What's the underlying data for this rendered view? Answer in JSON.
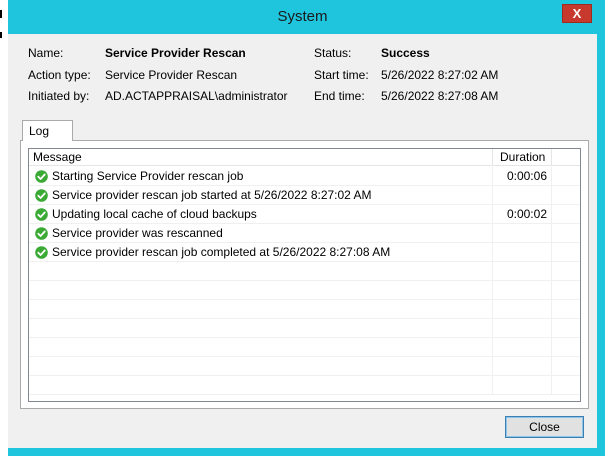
{
  "window": {
    "title": "System",
    "close_glyph": "X"
  },
  "details": {
    "name_label": "Name:",
    "name_value": "Service Provider Rescan",
    "action_label": "Action type:",
    "action_value": "Service Provider Rescan",
    "initiated_label": "Initiated by:",
    "initiated_value": "AD.ACTAPPRAISAL\\administrator",
    "status_label": "Status:",
    "status_value": "Success",
    "start_label": "Start time:",
    "start_value": "5/26/2022 8:27:02 AM",
    "end_label": "End time:",
    "end_value": "5/26/2022 8:27:08 AM"
  },
  "tabs": {
    "log_label": "Log"
  },
  "log": {
    "columns": {
      "message": "Message",
      "duration": "Duration"
    },
    "rows": [
      {
        "icon": "success-check-icon",
        "message": "Starting Service Provider rescan job",
        "duration": "0:00:06"
      },
      {
        "icon": "success-check-icon",
        "message": "Service provider rescan job started at 5/26/2022 8:27:02 AM",
        "duration": ""
      },
      {
        "icon": "success-check-icon",
        "message": "Updating local cache of cloud backups",
        "duration": "0:00:02"
      },
      {
        "icon": "success-check-icon",
        "message": "Service provider was rescanned",
        "duration": ""
      },
      {
        "icon": "success-check-icon",
        "message": "Service provider rescan job completed at 5/26/2022 8:27:08 AM",
        "duration": ""
      }
    ]
  },
  "footer": {
    "close_label": "Close"
  },
  "colors": {
    "titlebar": "#1fc4dd",
    "success": "#3aaa35",
    "close_x": "#c7392c"
  }
}
